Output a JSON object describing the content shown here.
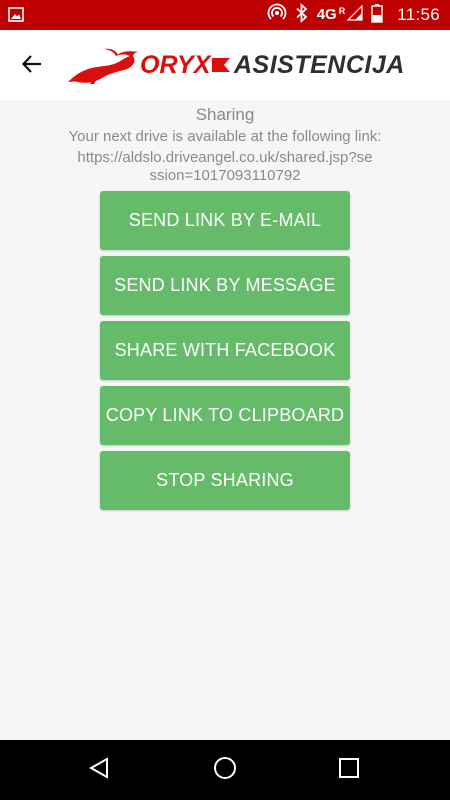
{
  "status_bar": {
    "network": "4G",
    "roaming": "R",
    "time": "11:56",
    "icons": [
      "image-icon",
      "hotspot-icon",
      "bluetooth-icon",
      "signal-icon",
      "battery-icon"
    ],
    "background_color": "#bd0000"
  },
  "app_bar": {
    "back_icon": "arrow-left-icon",
    "logo_part1": "ORYX",
    "logo_part2": "ASISTENCIJA",
    "brand_red": "#d90f0f"
  },
  "content": {
    "title": "Sharing",
    "subtitle": "Your next drive is available at the following link:",
    "link": "https://aldslo.driveangel.co.uk/shared.jsp?session=1017093110792"
  },
  "buttons": {
    "send_email": "SEND LINK BY E-MAIL",
    "send_message": "SEND LINK BY MESSAGE",
    "share_facebook": "SHARE WITH FACEBOOK",
    "copy_clipboard": "COPY LINK TO CLIPBOARD",
    "stop_sharing": "STOP SHARING",
    "color": "#66bb6a"
  },
  "nav_bar": {
    "icons": [
      "nav-back-icon",
      "nav-home-icon",
      "nav-recents-icon"
    ]
  }
}
